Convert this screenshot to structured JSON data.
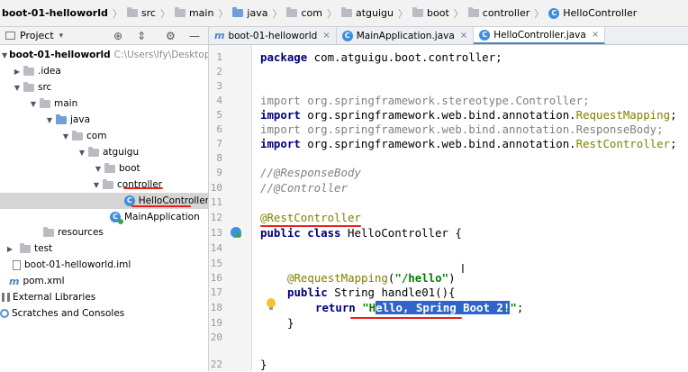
{
  "breadcrumb": {
    "items": [
      "boot-01-helloworld",
      "src",
      "main",
      "java",
      "com",
      "atguigu",
      "boot",
      "controller",
      "HelloController"
    ]
  },
  "project_panel": {
    "title": "Project",
    "dropdown_glyph": "▾",
    "icons": [
      "locate-icon",
      "collapse-icon",
      "gear-icon",
      "hide-icon"
    ]
  },
  "tree": {
    "root_label": "boot-01-helloworld",
    "root_path": "C:\\Users\\lfy\\Desktop\\boot",
    "idea": ".idea",
    "src": "src",
    "main": "main",
    "java": "java",
    "com": "com",
    "atguigu": "atguigu",
    "boot": "boot",
    "controller": "controller",
    "hello_controller": "HelloController",
    "main_application": "MainApplication",
    "resources": "resources",
    "test": "test",
    "iml": "boot-01-helloworld.iml",
    "pom": "pom.xml",
    "external_libraries": "External Libraries",
    "scratches": "Scratches and Consoles"
  },
  "tabs": [
    {
      "label": "boot-01-helloworld",
      "icon": "m",
      "active": false
    },
    {
      "label": "MainApplication.java",
      "icon": "c",
      "active": false
    },
    {
      "label": "HelloController.java",
      "icon": "c",
      "active": true
    }
  ],
  "tab_close": "×",
  "code": {
    "line_numbers": [
      "1",
      "2",
      "3",
      "4",
      "5",
      "6",
      "7",
      "8",
      "9",
      "10",
      "11",
      "12",
      "13",
      "14",
      "15",
      "16",
      "17",
      "18",
      "19",
      "20",
      "22"
    ],
    "l1_kw": "package",
    "l1_rest": " com.atguigu.boot.controller;",
    "l4_kw": "import",
    "l4_rest": " org.springframework.stereotype.Controller;",
    "l5_kw": "import",
    "l5_rest": " org.springframework.web.bind.annotation.",
    "l5_ann": "RequestMapping",
    "l5_tail": ";",
    "l6_kw": "import",
    "l6_rest": " org.springframework.web.bind.annotation.ResponseBody;",
    "l7_kw": "import",
    "l7_rest": " org.springframework.web.bind.annotation.",
    "l7_ann": "RestController",
    "l7_tail": ";",
    "l9": "//@ResponseBody",
    "l10": "//@Controller",
    "l12": "@RestController",
    "l13_kw": "public class",
    "l13_rest": " HelloController {",
    "l16_ann": "@RequestMapping",
    "l16_open": "(",
    "l16_str": "\"/hello\"",
    "l16_close": ")",
    "l17_kw": "public",
    "l17_rest": " String handle01(){",
    "l18_kw": "return",
    "l18_q": " \"H",
    "l18_sel": "ello, Spring Boot 2!",
    "l18_endq": "\"",
    "l18_semi": ";",
    "l19": "}",
    "l22": "}"
  },
  "cursor_glyph": "I",
  "colors": {
    "keyword": "#000080",
    "string": "#008000",
    "annotation": "#808000",
    "comment": "#808080",
    "selection": "#2f65ca",
    "underline": "#e8201a"
  }
}
